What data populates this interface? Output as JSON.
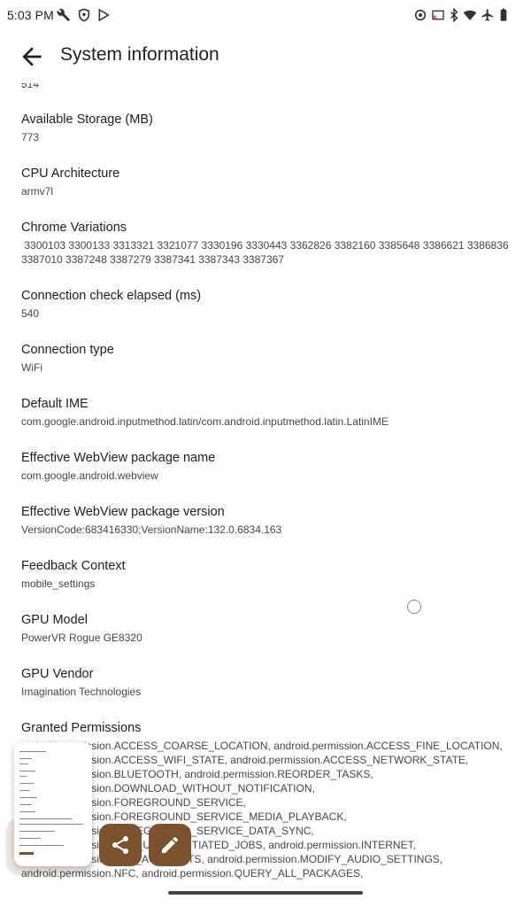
{
  "status": {
    "time": "5:03 PM",
    "icons_left": [
      "wrench-icon",
      "shield-icon",
      "play-store-icon"
    ],
    "icons_right": [
      "data-saver-icon",
      "cast-icon",
      "bluetooth-icon",
      "wifi-icon",
      "airplane-icon",
      "battery-icon"
    ]
  },
  "app_bar": {
    "title": "System information",
    "back_icon": "arrow-back-icon"
  },
  "list": {
    "cut_value": "514",
    "items": [
      {
        "title": "Available Storage (MB)",
        "value": "773"
      },
      {
        "title": "CPU Architecture",
        "value": "armv7l"
      },
      {
        "title": "Chrome Variations",
        "value": " 3300103 3300133 3313321 3321077 3330196 3330443 3362826 3382160 3385648 3386621 3386836\n3387010 3387248 3387279 3387341 3387343 3387367"
      },
      {
        "title": "Connection check elapsed (ms)",
        "value": "540"
      },
      {
        "title": "Connection type",
        "value": "WiFi"
      },
      {
        "title": "Default IME",
        "value": "com.google.android.inputmethod.latin/com.android.inputmethod.latin.LatinIME"
      },
      {
        "title": "Effective WebView package name",
        "value": "com.google.android.webview"
      },
      {
        "title": "Effective WebView package version",
        "value": "VersionCode:683416330;VersionName:132.0.6834.163"
      },
      {
        "title": "Feedback Context",
        "value": "mobile_settings"
      },
      {
        "title": "GPU Model",
        "value": "PowerVR Rogue GE8320"
      },
      {
        "title": "GPU Vendor",
        "value": "Imagination Technologies"
      },
      {
        "title": "Granted Permissions",
        "value": "android.permission.ACCESS_COARSE_LOCATION, android.permission.ACCESS_FINE_LOCATION,\nandroid.permission.ACCESS_WIFI_STATE, android.permission.ACCESS_NETWORK_STATE,\nandroid.permission.BLUETOOTH, android.permission.REORDER_TASKS,\nandroid.permission.DOWNLOAD_WITHOUT_NOTIFICATION,\nandroid.permission.FOREGROUND_SERVICE,\nandroid.permission.FOREGROUND_SERVICE_MEDIA_PLAYBACK,\nandroid.permission.FOREGROUND_SERVICE_DATA_SYNC,\nandroid.permission.RUN_USER_INITIATED_JOBS, android.permission.INTERNET,\nandroid.permission.GET_ACCOUNTS, android.permission.MODIFY_AUDIO_SETTINGS,\nandroid.permission.NFC, android.permission.QUERY_ALL_PACKAGES,"
      }
    ]
  },
  "screenshot_preview": {
    "share_icon": "share-icon",
    "edit_icon": "edit-pencil-icon"
  },
  "colors": {
    "accent_brown": "#7a5230",
    "text_primary": "#1f1f1f",
    "text_secondary": "#444746"
  }
}
